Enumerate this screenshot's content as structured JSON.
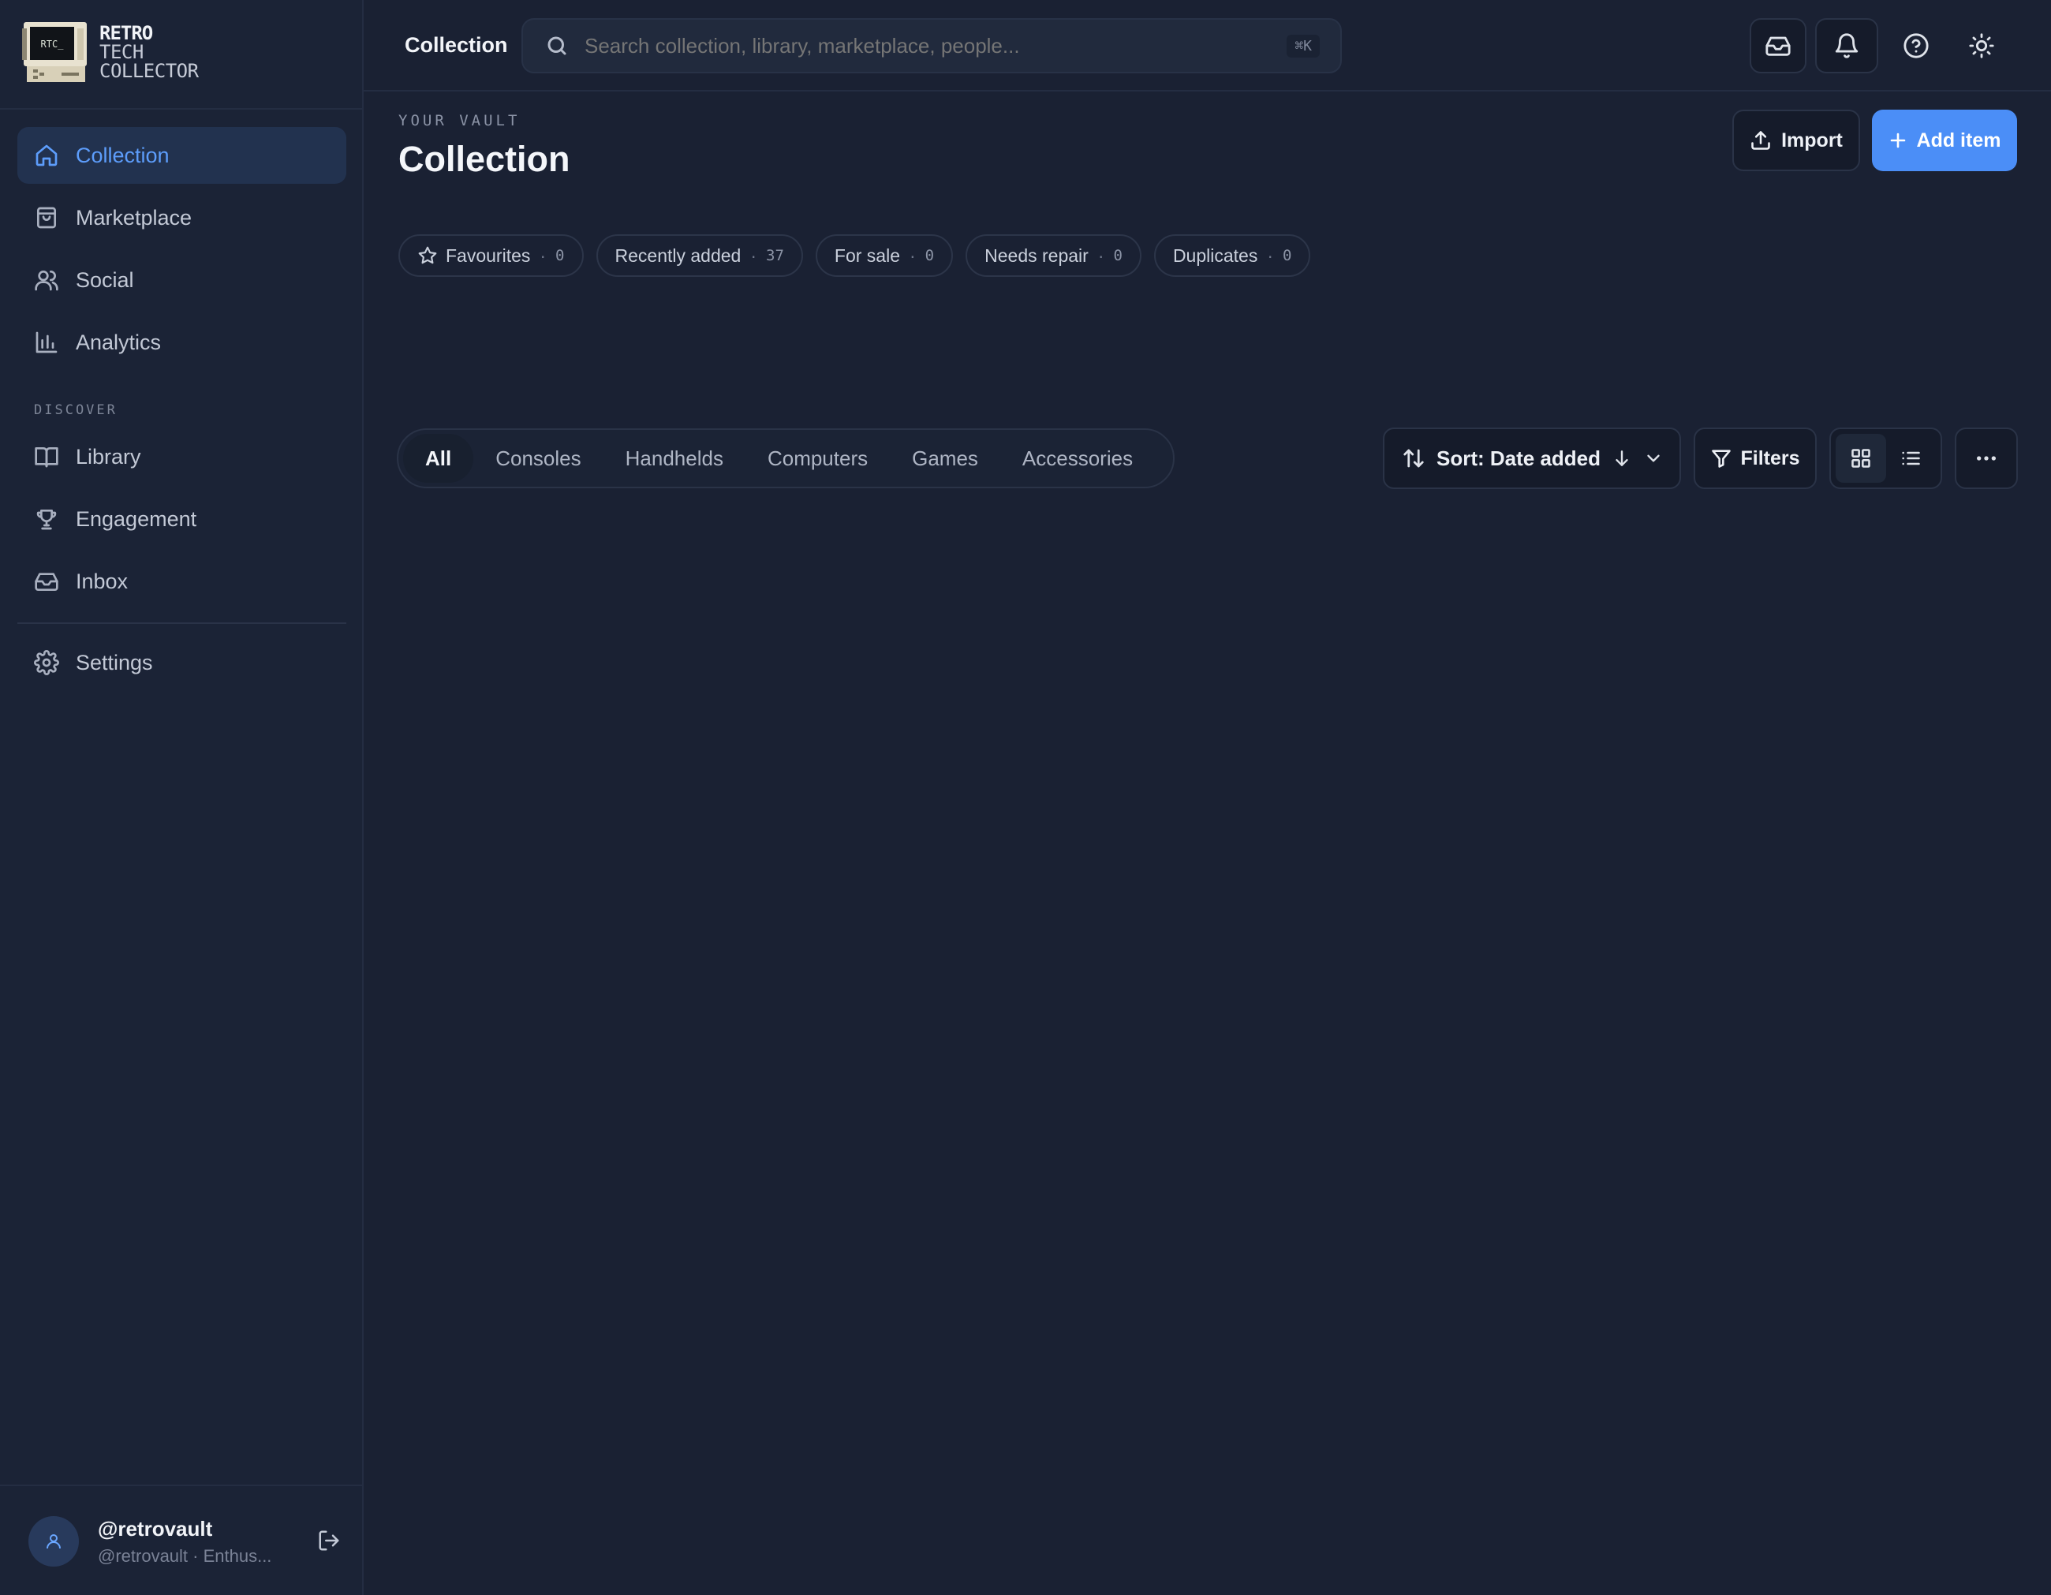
{
  "brand": {
    "line1": "RETRO",
    "line2": "TECH",
    "line3": "COLLECTOR",
    "icon_text": "RTC_"
  },
  "sidebar": {
    "items": [
      {
        "label": "Collection",
        "icon": "home-icon",
        "active": true
      },
      {
        "label": "Marketplace",
        "icon": "shopping-bag-icon"
      },
      {
        "label": "Social",
        "icon": "users-icon"
      },
      {
        "label": "Analytics",
        "icon": "bar-chart-icon"
      }
    ],
    "section_label": "DISCOVER",
    "discover_items": [
      {
        "label": "Library",
        "icon": "book-icon"
      },
      {
        "label": "Engagement",
        "icon": "trophy-icon"
      },
      {
        "label": "Inbox",
        "icon": "inbox-icon"
      }
    ],
    "settings_label": "Settings"
  },
  "user": {
    "name": "@retrovault",
    "subtitle": "@retrovault · Enthus..."
  },
  "topbar": {
    "title": "Collection",
    "search_placeholder": "Search collection, library, marketplace, people...",
    "shortcut": "⌘K"
  },
  "header": {
    "eyebrow": "YOUR VAULT",
    "title": "Collection",
    "import_label": "Import",
    "add_label": "Add item"
  },
  "chips": [
    {
      "label": "Favourites",
      "count": "0",
      "icon": "star-icon"
    },
    {
      "label": "Recently added",
      "count": "37"
    },
    {
      "label": "For sale",
      "count": "0"
    },
    {
      "label": "Needs repair",
      "count": "0"
    },
    {
      "label": "Duplicates",
      "count": "0"
    }
  ],
  "tabs": [
    "All",
    "Consoles",
    "Handhelds",
    "Computers",
    "Games",
    "Accessories"
  ],
  "sort_label": "Sort: Date added",
  "filters_label": "Filters",
  "colors": {
    "accent": "#4b8ef7",
    "active_nav": "#5d9dfb",
    "background": "#1a2133",
    "sidebar": "#1b2336"
  }
}
